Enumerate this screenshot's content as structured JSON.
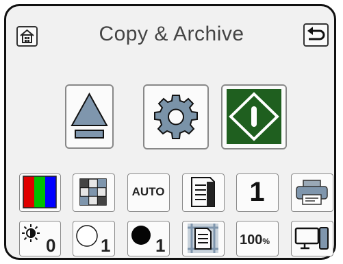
{
  "header": {
    "title": "Copy & Archive",
    "home_icon": "home-icon",
    "back_icon": "back-arrow-icon"
  },
  "main_buttons": [
    {
      "name": "eject-button",
      "icon": "eject-icon"
    },
    {
      "name": "settings-button",
      "icon": "gear-icon"
    },
    {
      "name": "start-button",
      "icon": "start-diamond-icon"
    }
  ],
  "row1": {
    "color_mode_icon": "rgb-color-icon",
    "grid_icon": "grid-pattern-icon",
    "auto_label": "AUTO",
    "duplex_icon": "document-duplex-icon",
    "copies_value": "1",
    "printer_icon": "printer-icon"
  },
  "row2": {
    "brightness_value": "0",
    "light_value": "1",
    "dark_value": "1",
    "crop_icon": "document-crop-icon",
    "zoom_label": "100",
    "zoom_unit": "%",
    "display_icon": "screen-device-icon"
  },
  "colors": {
    "start_green": "#1f5f1f",
    "eject_blue": "#7f96ad",
    "gear_gray": "#7a93a8"
  }
}
